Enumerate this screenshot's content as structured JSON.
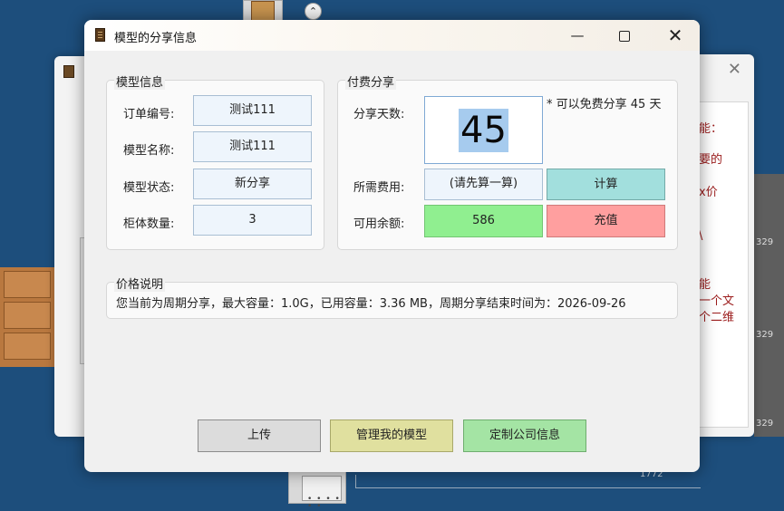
{
  "background": {
    "top_circle_glyph": "⌃",
    "right_window_lines": [
      "能：",
      "要的",
      "x价",
      "\\",
      "能",
      "一个文",
      "个二维"
    ],
    "right_numbers": [
      "329",
      "329",
      "329"
    ],
    "bottom_label": "1772"
  },
  "dialog": {
    "title": "模型的分享信息",
    "controls": {
      "minimize": "—",
      "maximize": "☐",
      "close": "✕"
    },
    "model_info": {
      "group_title": "模型信息",
      "order_no_label": "订单编号:",
      "order_no": "测试111",
      "model_name_label": "模型名称:",
      "model_name": "测试111",
      "status_label": "模型状态:",
      "status": "新分享",
      "cabinet_count_label": "柜体数量:",
      "cabinet_count": "3"
    },
    "paid_share": {
      "group_title": "付费分享",
      "days_label": "分享天数:",
      "days_value": "45",
      "free_note": "* 可以免费分享 45 天",
      "fee_label": "所需费用:",
      "fee_value": "(请先算一算)",
      "calc_button": "计算",
      "balance_label": "可用余额:",
      "balance_value": "586",
      "recharge_button": "充值"
    },
    "price_info": {
      "group_title": "价格说明",
      "text": "您当前为周期分享，最大容量：1.0G，已用容量：3.36 MB，周期分享结束时间为：2026-09-26"
    },
    "buttons": {
      "upload": "上传",
      "manage": "管理我的模型",
      "custom": "定制公司信息"
    }
  }
}
